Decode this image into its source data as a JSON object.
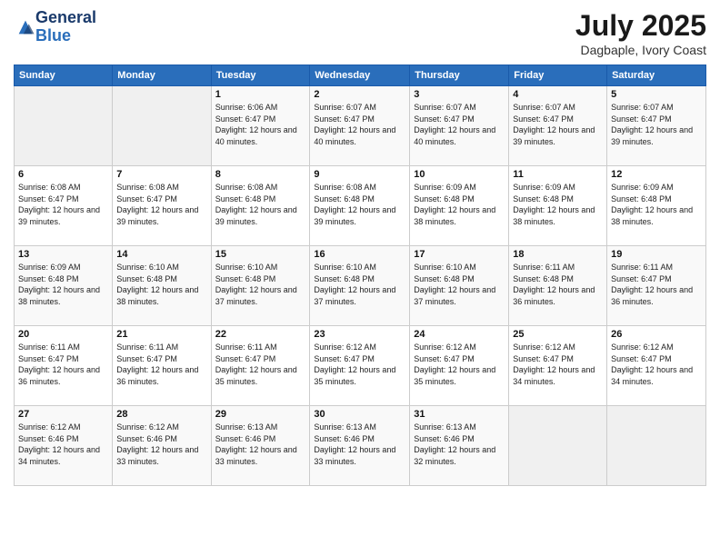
{
  "logo": {
    "line1": "General",
    "line2": "Blue"
  },
  "header": {
    "month": "July 2025",
    "location": "Dagbaple, Ivory Coast"
  },
  "weekdays": [
    "Sunday",
    "Monday",
    "Tuesday",
    "Wednesday",
    "Thursday",
    "Friday",
    "Saturday"
  ],
  "weeks": [
    [
      {
        "day": "",
        "info": ""
      },
      {
        "day": "",
        "info": ""
      },
      {
        "day": "1",
        "info": "Sunrise: 6:06 AM\nSunset: 6:47 PM\nDaylight: 12 hours and 40 minutes."
      },
      {
        "day": "2",
        "info": "Sunrise: 6:07 AM\nSunset: 6:47 PM\nDaylight: 12 hours and 40 minutes."
      },
      {
        "day": "3",
        "info": "Sunrise: 6:07 AM\nSunset: 6:47 PM\nDaylight: 12 hours and 40 minutes."
      },
      {
        "day": "4",
        "info": "Sunrise: 6:07 AM\nSunset: 6:47 PM\nDaylight: 12 hours and 39 minutes."
      },
      {
        "day": "5",
        "info": "Sunrise: 6:07 AM\nSunset: 6:47 PM\nDaylight: 12 hours and 39 minutes."
      }
    ],
    [
      {
        "day": "6",
        "info": "Sunrise: 6:08 AM\nSunset: 6:47 PM\nDaylight: 12 hours and 39 minutes."
      },
      {
        "day": "7",
        "info": "Sunrise: 6:08 AM\nSunset: 6:47 PM\nDaylight: 12 hours and 39 minutes."
      },
      {
        "day": "8",
        "info": "Sunrise: 6:08 AM\nSunset: 6:48 PM\nDaylight: 12 hours and 39 minutes."
      },
      {
        "day": "9",
        "info": "Sunrise: 6:08 AM\nSunset: 6:48 PM\nDaylight: 12 hours and 39 minutes."
      },
      {
        "day": "10",
        "info": "Sunrise: 6:09 AM\nSunset: 6:48 PM\nDaylight: 12 hours and 38 minutes."
      },
      {
        "day": "11",
        "info": "Sunrise: 6:09 AM\nSunset: 6:48 PM\nDaylight: 12 hours and 38 minutes."
      },
      {
        "day": "12",
        "info": "Sunrise: 6:09 AM\nSunset: 6:48 PM\nDaylight: 12 hours and 38 minutes."
      }
    ],
    [
      {
        "day": "13",
        "info": "Sunrise: 6:09 AM\nSunset: 6:48 PM\nDaylight: 12 hours and 38 minutes."
      },
      {
        "day": "14",
        "info": "Sunrise: 6:10 AM\nSunset: 6:48 PM\nDaylight: 12 hours and 38 minutes."
      },
      {
        "day": "15",
        "info": "Sunrise: 6:10 AM\nSunset: 6:48 PM\nDaylight: 12 hours and 37 minutes."
      },
      {
        "day": "16",
        "info": "Sunrise: 6:10 AM\nSunset: 6:48 PM\nDaylight: 12 hours and 37 minutes."
      },
      {
        "day": "17",
        "info": "Sunrise: 6:10 AM\nSunset: 6:48 PM\nDaylight: 12 hours and 37 minutes."
      },
      {
        "day": "18",
        "info": "Sunrise: 6:11 AM\nSunset: 6:48 PM\nDaylight: 12 hours and 36 minutes."
      },
      {
        "day": "19",
        "info": "Sunrise: 6:11 AM\nSunset: 6:47 PM\nDaylight: 12 hours and 36 minutes."
      }
    ],
    [
      {
        "day": "20",
        "info": "Sunrise: 6:11 AM\nSunset: 6:47 PM\nDaylight: 12 hours and 36 minutes."
      },
      {
        "day": "21",
        "info": "Sunrise: 6:11 AM\nSunset: 6:47 PM\nDaylight: 12 hours and 36 minutes."
      },
      {
        "day": "22",
        "info": "Sunrise: 6:11 AM\nSunset: 6:47 PM\nDaylight: 12 hours and 35 minutes."
      },
      {
        "day": "23",
        "info": "Sunrise: 6:12 AM\nSunset: 6:47 PM\nDaylight: 12 hours and 35 minutes."
      },
      {
        "day": "24",
        "info": "Sunrise: 6:12 AM\nSunset: 6:47 PM\nDaylight: 12 hours and 35 minutes."
      },
      {
        "day": "25",
        "info": "Sunrise: 6:12 AM\nSunset: 6:47 PM\nDaylight: 12 hours and 34 minutes."
      },
      {
        "day": "26",
        "info": "Sunrise: 6:12 AM\nSunset: 6:47 PM\nDaylight: 12 hours and 34 minutes."
      }
    ],
    [
      {
        "day": "27",
        "info": "Sunrise: 6:12 AM\nSunset: 6:46 PM\nDaylight: 12 hours and 34 minutes."
      },
      {
        "day": "28",
        "info": "Sunrise: 6:12 AM\nSunset: 6:46 PM\nDaylight: 12 hours and 33 minutes."
      },
      {
        "day": "29",
        "info": "Sunrise: 6:13 AM\nSunset: 6:46 PM\nDaylight: 12 hours and 33 minutes."
      },
      {
        "day": "30",
        "info": "Sunrise: 6:13 AM\nSunset: 6:46 PM\nDaylight: 12 hours and 33 minutes."
      },
      {
        "day": "31",
        "info": "Sunrise: 6:13 AM\nSunset: 6:46 PM\nDaylight: 12 hours and 32 minutes."
      },
      {
        "day": "",
        "info": ""
      },
      {
        "day": "",
        "info": ""
      }
    ]
  ]
}
